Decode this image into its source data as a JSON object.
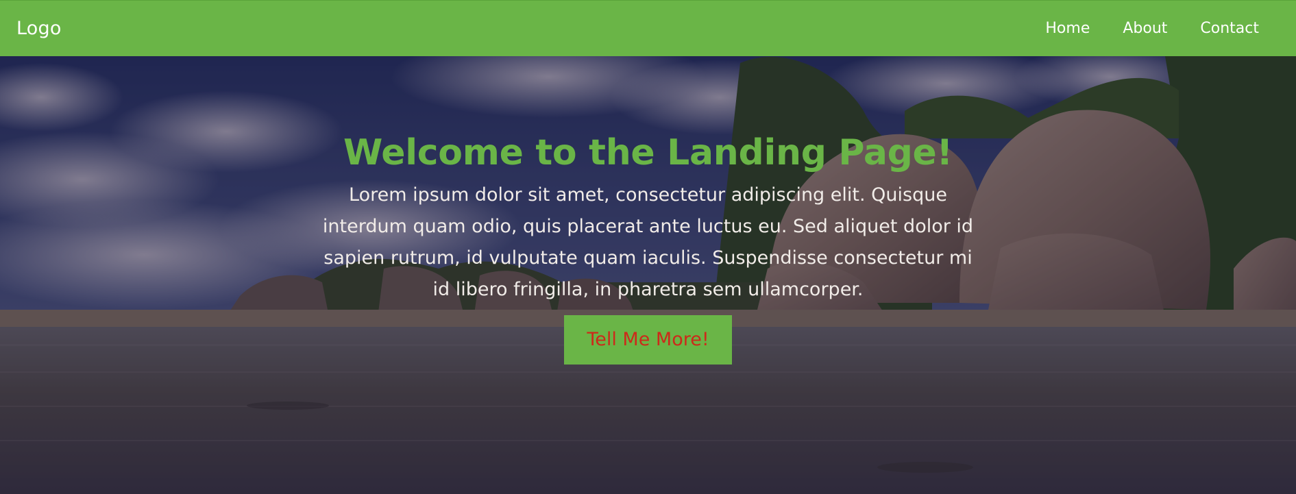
{
  "navbar": {
    "logo": "Logo",
    "links": [
      "Home",
      "About",
      "Contact"
    ],
    "background": "#6ab547"
  },
  "hero": {
    "title": "Welcome to the Landing Page!",
    "text": "Lorem ipsum dolor sit amet, consectetur adipiscing elit. Quisque interdum quam odio, quis placerat ante luctus eu. Sed aliquet dolor id sapien rutrum, id vulputate quam iaculis. Suspendisse consectetur mi id libero fringilla, in pharetra sem ullamcorper.",
    "button_label": "Tell Me More!",
    "title_color": "#6ab547",
    "button_text_color": "#cc2a1a",
    "background_image": "tropical-beach-granite-boulders"
  }
}
